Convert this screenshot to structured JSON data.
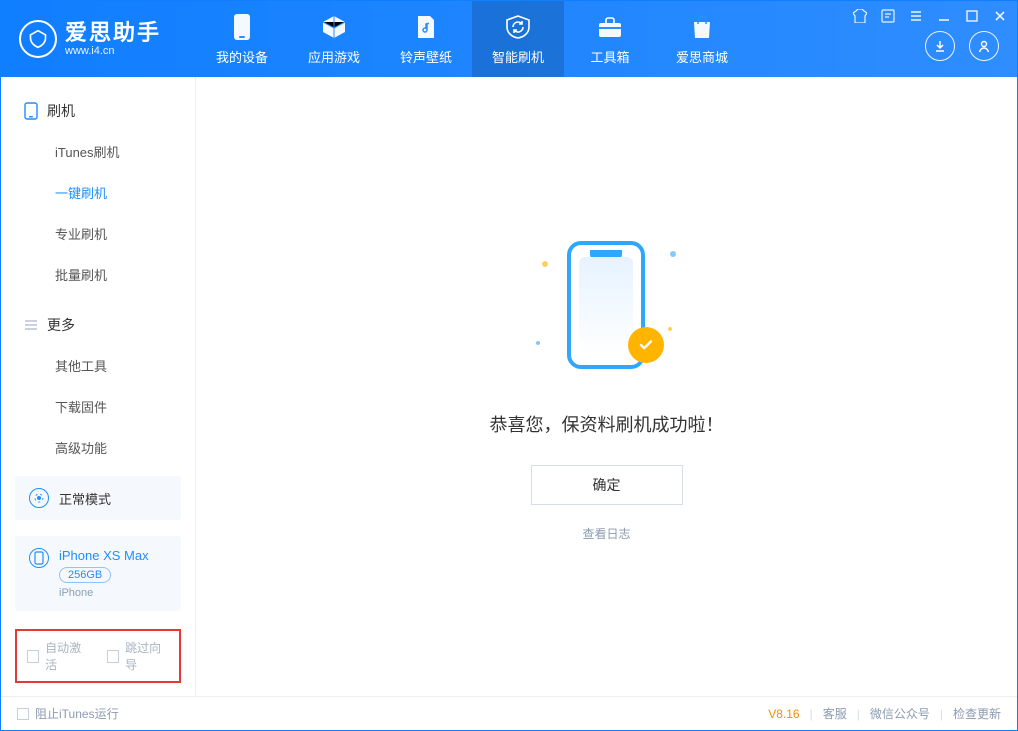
{
  "app": {
    "name_cn": "爱思助手",
    "name_en": "www.i4.cn"
  },
  "topnav": {
    "items": [
      {
        "label": "我的设备"
      },
      {
        "label": "应用游戏"
      },
      {
        "label": "铃声壁纸"
      },
      {
        "label": "智能刷机"
      },
      {
        "label": "工具箱"
      },
      {
        "label": "爱思商城"
      }
    ],
    "active_index": 3
  },
  "sidebar": {
    "sections": [
      {
        "title": "刷机",
        "items": [
          {
            "label": "iTunes刷机"
          },
          {
            "label": "一键刷机"
          },
          {
            "label": "专业刷机"
          },
          {
            "label": "批量刷机"
          }
        ],
        "active_index": 1
      },
      {
        "title": "更多",
        "items": [
          {
            "label": "其他工具"
          },
          {
            "label": "下载固件"
          },
          {
            "label": "高级功能"
          }
        ],
        "active_index": -1
      }
    ],
    "mode_card": {
      "label": "正常模式"
    },
    "device_card": {
      "name": "iPhone XS Max",
      "capacity": "256GB",
      "type": "iPhone"
    },
    "options": {
      "auto_activate_label": "自动激活",
      "skip_wizard_label": "跳过向导"
    }
  },
  "main": {
    "success_text": "恭喜您，保资料刷机成功啦！",
    "ok_label": "确定",
    "view_log_label": "查看日志"
  },
  "statusbar": {
    "block_itunes_label": "阻止iTunes运行",
    "version": "V8.16",
    "links": {
      "support": "客服",
      "wechat": "微信公众号",
      "update": "检查更新"
    }
  }
}
